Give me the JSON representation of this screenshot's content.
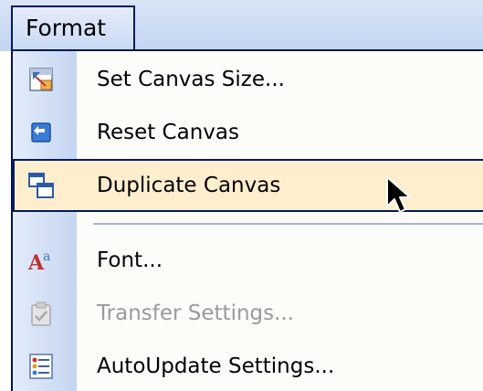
{
  "menubar": {
    "active_menu_label": "Format"
  },
  "menu": {
    "items": [
      {
        "label": "Set Canvas Size...",
        "icon": "canvas-size-icon",
        "enabled": true,
        "highlighted": false
      },
      {
        "label": "Reset Canvas",
        "icon": "reset-canvas-icon",
        "enabled": true,
        "highlighted": false
      },
      {
        "label": "Duplicate Canvas",
        "icon": "duplicate-canvas-icon",
        "enabled": true,
        "highlighted": true
      },
      {
        "label": "Font...",
        "icon": "font-icon",
        "enabled": true,
        "highlighted": false
      },
      {
        "label": "Transfer Settings...",
        "icon": "transfer-settings-icon",
        "enabled": false,
        "highlighted": false
      },
      {
        "label": "AutoUpdate Settings...",
        "icon": "autoupdate-settings-icon",
        "enabled": true,
        "highlighted": false
      }
    ]
  },
  "colors": {
    "gutter_start": "#e3ecfa",
    "gutter_end": "#c5d6f1",
    "highlight_bg": "#ffeecd",
    "border": "#001a63",
    "disabled_text": "#9a9a9a"
  }
}
